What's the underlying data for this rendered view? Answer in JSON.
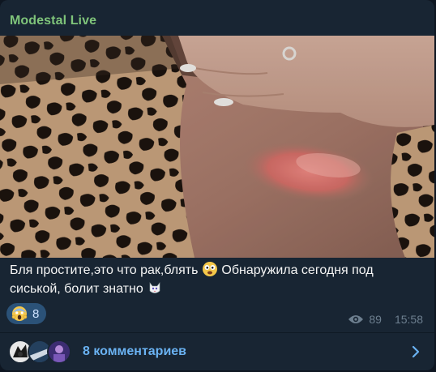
{
  "post": {
    "channel_name": "Modestal Live",
    "caption_line1_a": "Бля простите,это что рак,блять ",
    "caption_line1_b": " Обнаружила сегодня под",
    "caption_line2": "сиськой, болит знатно ",
    "emoji_1": "face-emoji",
    "emoji_2": "cat-emoji",
    "reaction": {
      "icon": "screaming-face-emoji",
      "count": "8"
    },
    "views": "89",
    "time": "15:58",
    "comments_label": "8 комментариев"
  },
  "colors": {
    "background": "#0e1621",
    "bubble": "#182533",
    "channel_name": "#7fc47a",
    "link": "#6ab2f2",
    "reaction_bg": "#2b5278",
    "meta": "#6d7f8f"
  }
}
